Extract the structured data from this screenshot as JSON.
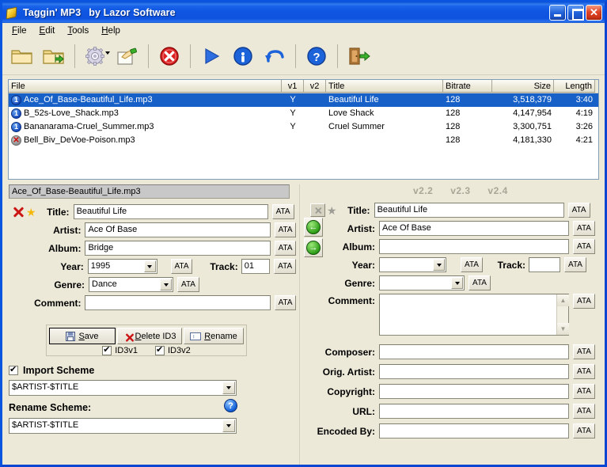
{
  "window": {
    "title": "Taggin' MP3",
    "subtitle": "by Lazor Software",
    "app_icon": "tag-icon",
    "buttons": {
      "minimize": "minimize",
      "maximize": "maximize",
      "close": "close"
    },
    "accent": "#0d52e0",
    "face": "#ece9d8"
  },
  "menu": [
    {
      "label": "File",
      "accel": "F"
    },
    {
      "label": "Edit",
      "accel": "E"
    },
    {
      "label": "Tools",
      "accel": "T"
    },
    {
      "label": "Help",
      "accel": "H"
    }
  ],
  "toolbar": [
    {
      "name": "open-folder-icon",
      "title": "Open Folder"
    },
    {
      "name": "open-folder-arrow-icon",
      "title": "Open Subfolders"
    },
    {
      "sep": true
    },
    {
      "name": "gear-options-icon",
      "title": "Options",
      "dropdown": true
    },
    {
      "name": "hand-write-icon",
      "title": "Manual Edit"
    },
    {
      "sep": true
    },
    {
      "name": "delete-red-x-icon",
      "title": "Delete"
    },
    {
      "sep": true
    },
    {
      "name": "play-icon",
      "title": "Play"
    },
    {
      "name": "info-icon",
      "title": "Info"
    },
    {
      "name": "undo-icon",
      "title": "Undo"
    },
    {
      "sep": true
    },
    {
      "name": "help-icon",
      "title": "Help"
    },
    {
      "sep": true
    },
    {
      "name": "exit-door-icon",
      "title": "Exit"
    }
  ],
  "filelist": {
    "columns": [
      "File",
      "v1",
      "v2",
      "Title",
      "Bitrate",
      "Size",
      "Length"
    ],
    "rows": [
      {
        "icon": "id3v1-badge",
        "file": "Ace_Of_Base-Beautiful_Life.mp3",
        "v1": "Y",
        "v2": "",
        "title": "Beautiful Life",
        "bitrate": "128",
        "size": "3,518,379",
        "length": "3:40",
        "selected": true
      },
      {
        "icon": "id3v1-badge",
        "file": "B_52s-Love_Shack.mp3",
        "v1": "Y",
        "v2": "",
        "title": "Love Shack",
        "bitrate": "128",
        "size": "4,147,954",
        "length": "4:19",
        "selected": false
      },
      {
        "icon": "id3v1-badge",
        "file": "Bananarama-Cruel_Summer.mp3",
        "v1": "Y",
        "v2": "",
        "title": "Cruel Summer",
        "bitrate": "128",
        "size": "3,300,751",
        "length": "3:26",
        "selected": false
      },
      {
        "icon": "no-tag-badge",
        "file": "Bell_Biv_DeVoe-Poison.mp3",
        "v1": "",
        "v2": "",
        "title": "",
        "bitrate": "128",
        "size": "4,181,330",
        "length": "4:21",
        "selected": false
      }
    ]
  },
  "left_panel": {
    "filename": "Ace_Of_Base-Beautiful_Life.mp3",
    "delete_tag_icon": "red-x-icon",
    "favorite_icon": "star-icon",
    "labels": {
      "title": "Title:",
      "artist": "Artist:",
      "album": "Album:",
      "year": "Year:",
      "track": "Track:",
      "genre": "Genre:",
      "comment": "Comment:"
    },
    "values": {
      "title": "Beautiful Life",
      "artist": "Ace Of Base",
      "album": "Bridge",
      "year": "1995",
      "track": "01",
      "genre": "Dance",
      "comment": ""
    },
    "ata_label": "ATA",
    "actions": {
      "save": "Save",
      "save_accel": "S",
      "delete_id3": "Delete ID3",
      "delete_accel": "D",
      "rename": "Rename",
      "rename_accel": "R",
      "save_icon": "floppy-disk-icon",
      "delete_icon": "red-x-icon",
      "rename_icon": "rename-icon"
    },
    "checkboxes": [
      {
        "label": "ID3v1",
        "checked": true
      },
      {
        "label": "ID3v2",
        "checked": true
      }
    ],
    "import_scheme": {
      "label": "Import Scheme",
      "checked": true,
      "value": "$ARTIST-$TITLE"
    },
    "rename_scheme": {
      "label": "Rename Scheme:",
      "value": "$ARTIST-$TITLE",
      "help_icon": "help-icon"
    }
  },
  "right_panel": {
    "version_tabs": [
      "v2.2",
      "v2.3",
      "v2.4"
    ],
    "delete_tag_icon": "grey-x-icon",
    "favorite_icon": "grey-star-icon",
    "transfer_left_icon": "green-left-arrow-icon",
    "transfer_right_icon": "green-right-arrow-icon",
    "labels": {
      "title": "Title:",
      "artist": "Artist:",
      "album": "Album:",
      "year": "Year:",
      "track": "Track:",
      "genre": "Genre:",
      "comment": "Comment:",
      "composer": "Composer:",
      "orig_artist": "Orig. Artist:",
      "copyright": "Copyright:",
      "url": "URL:",
      "encoded_by": "Encoded By:"
    },
    "values": {
      "title": "Beautiful Life",
      "artist": "Ace Of Base",
      "album": "",
      "year": "",
      "track": "",
      "genre": "",
      "comment": "",
      "composer": "",
      "orig_artist": "",
      "copyright": "",
      "url": "",
      "encoded_by": ""
    },
    "ata_label": "ATA"
  }
}
